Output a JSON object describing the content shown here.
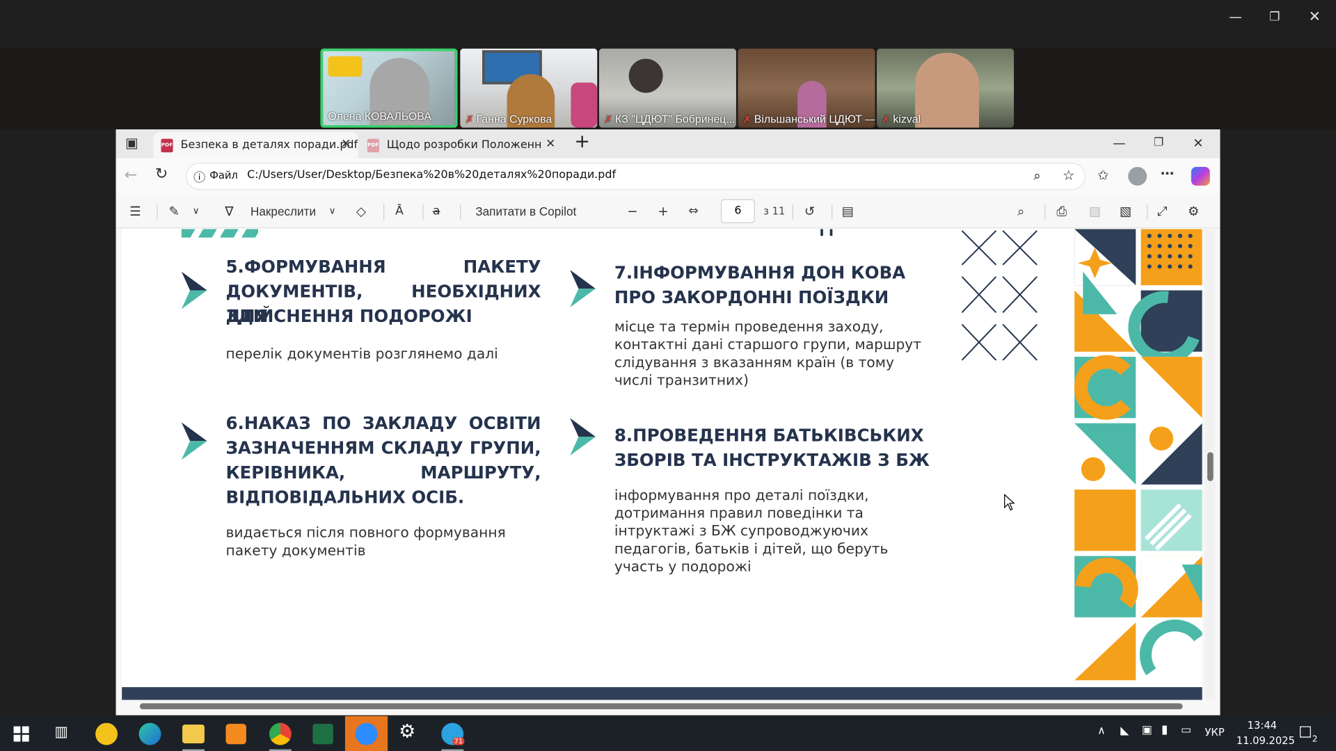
{
  "zoom": {
    "participants": [
      {
        "name": "Олена КОВАЛЬОВА",
        "muted": false
      },
      {
        "name": "Ганна Суркова",
        "muted": true
      },
      {
        "name": "КЗ \"ЦДЮТ\" Бобринец...",
        "muted": true
      },
      {
        "name": "Вільшанський ЦДЮТ —",
        "muted": true
      },
      {
        "name": "kizval",
        "muted": true
      }
    ]
  },
  "browser": {
    "tabs": [
      {
        "label": "Безпека в деталях поради.pdf",
        "active": true
      },
      {
        "label": "Щодо розробки Положення про",
        "active": false
      }
    ],
    "address": {
      "scheme_label": "Файл",
      "url": "C:/Users/User/Desktop/Безпека%20в%20деталях%20поради.pdf"
    },
    "pdf_toolbar": {
      "draw_label": "Накреслити",
      "copilot_label": "Запитати в Copilot",
      "page_current": "6",
      "page_total": "з 11"
    }
  },
  "document": {
    "items": [
      {
        "heading_lines": [
          "5.ФОРМУВАННЯ ПАКЕТУ",
          "ДОКУМЕНТІВ, НЕОБХІДНИХ ДЛЯ",
          "ЗДІЙСНЕННЯ ПОДОРОЖІ"
        ],
        "body_lines": [
          "перелік документів розглянемо далі"
        ]
      },
      {
        "heading_lines": [
          "6.НАКАЗ ПО ЗАКЛАДУ ОСВІТИ З",
          "ЗАЗНАЧЕННЯМ СКЛАДУ ГРУПИ,",
          "КЕРІВНИКА, МАРШРУТУ,",
          "ВІДПОВІДАЛЬНИХ ОСІБ."
        ],
        "body_lines": [
          "видається після повного формування",
          "пакету документів"
        ]
      },
      {
        "heading_lines": [
          "7.ІНФОРМУВАННЯ ДОН КОВА",
          "ПРО ЗАКОРДОННІ ПОЇЗДКИ"
        ],
        "body_lines": [
          "місце та термін проведення заходу,",
          "контактні дані старшого групи, маршрут",
          "слідування з вказанням країн (в тому",
          "числі транзитних)"
        ]
      },
      {
        "heading_lines": [
          "8.ПРОВЕДЕННЯ БАТЬКІВСЬКИХ",
          "ЗБОРІВ ТА ІНСТРУКТАЖІВ З БЖ"
        ],
        "body_lines": [
          "інформування про деталі поїздки,",
          "дотримання правил поведінки та",
          "інтруктажі з БЖ супроводжуючих",
          "педагогів, батьків і дітей, що беруть",
          "участь у подорожі"
        ]
      }
    ]
  },
  "taskbar": {
    "telegram_badge": "71",
    "language": "УКР",
    "time": "13:44",
    "date": "11.09.2025",
    "notifications": "2"
  },
  "colors": {
    "navy": "#25334d",
    "teal": "#4cb9a8",
    "orange": "#f5a01a",
    "dark": "#2f4058"
  }
}
